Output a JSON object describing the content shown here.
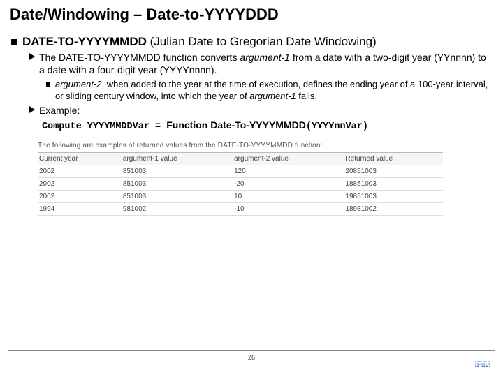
{
  "title": "Date/Windowing – Date-to-YYYYDDD",
  "bullet1": {
    "bold": "DATE-TO-YYYYMMDD",
    "rest": " (Julian Date to Gregorian Date Windowing)"
  },
  "bullet2a": {
    "pre": "The DATE-TO-YYYYMMDD function converts ",
    "italic": "argument-1",
    "post": " from a date with a two-digit year (YYnnnn) to a date with a four-digit year (YYYYnnnn)."
  },
  "bullet3": {
    "i1": "argument-2",
    "t1": ", when added to the year at the time of execution, defines the ending year of a 100-year interval, or sliding century window, into which the year of ",
    "i2": "argument-1",
    "t2": " falls."
  },
  "bullet2b": "Example:",
  "code": {
    "lhs": "Compute YYYYMMDDVar = ",
    "fn": "Function Date-To-YYYYMMDD",
    "arg": "(YYYYnnVar)"
  },
  "table_caption": "The following are examples of returned values from the DATE-TO-YYYYMMDD function:",
  "table": {
    "headers": [
      "Current year",
      "argument-1 value",
      "argument-2 value",
      "Returned value"
    ],
    "rows": [
      [
        "2002",
        "851003",
        "120",
        "20851003"
      ],
      [
        "2002",
        "851003",
        "-20",
        "18851003"
      ],
      [
        "2002",
        "851003",
        "10",
        "19851003"
      ],
      [
        "1994",
        "981002",
        "-10",
        "18981002"
      ]
    ]
  },
  "page_number": "26",
  "logo_text": "IBM"
}
